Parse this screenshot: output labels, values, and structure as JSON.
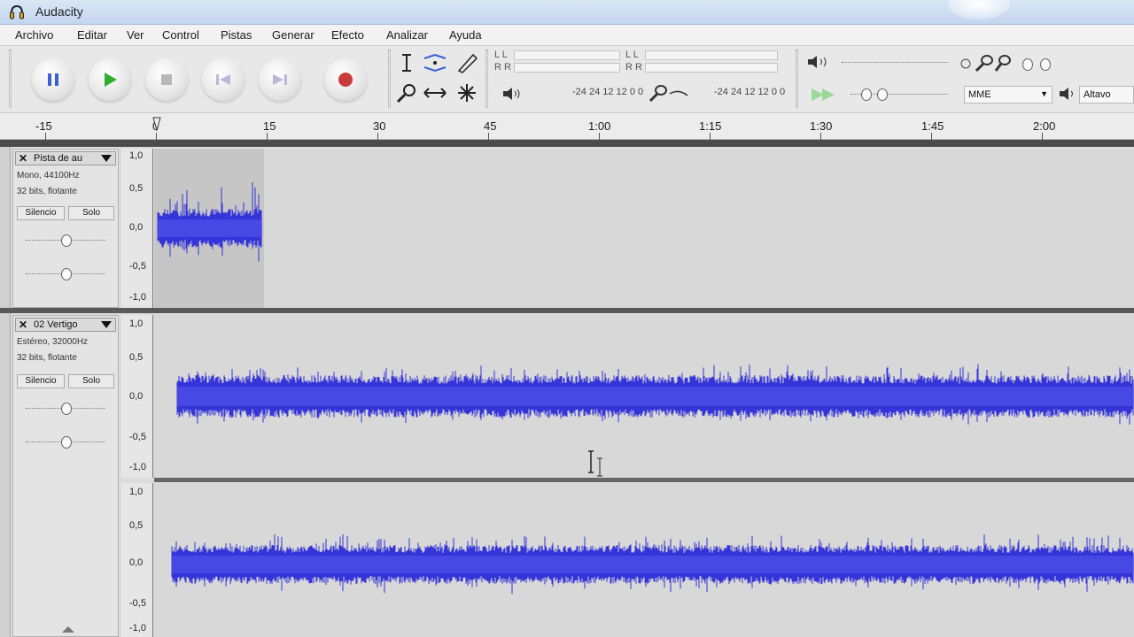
{
  "window": {
    "title": "Audacity"
  },
  "menu": {
    "items": [
      "Archivo",
      "Editar",
      "Ver",
      "Control",
      "Pistas",
      "Generar",
      "Efecto",
      "Analizar",
      "Ayuda"
    ]
  },
  "toolbar": {
    "transport": [
      "pause-icon",
      "play-icon",
      "stop-icon",
      "skip-start-icon",
      "skip-end-icon",
      "record-icon"
    ],
    "tools": [
      "selection-tool-icon",
      "envelope-tool-icon",
      "draw-tool-icon",
      "zoom-tool-icon",
      "timeshift-tool-icon",
      "multi-tool-icon"
    ],
    "meter_left_label": "L L",
    "meter_right_label": "R R",
    "meter_left_label_2": "L L",
    "meter_right_label_2": "R R",
    "meter_scale_a": "-24 24 12 12 0  0",
    "meter_scale_b": "-24 24 12 12 0  0",
    "device_combo": "MME",
    "output_combo": "Altavo",
    "colors": {
      "play": "#2fae2f",
      "pause": "#3a5fd6",
      "record": "#c93b3b",
      "disabled": "#b8b8b8"
    }
  },
  "ruler": {
    "labels": [
      "-15",
      "0",
      "15",
      "30",
      "45",
      "1:00",
      "1:15",
      "1:30",
      "1:45",
      "2:00"
    ]
  },
  "tracks": [
    {
      "name": "Pista de au",
      "info_line1": "Mono, 44100Hz",
      "info_line2": "32 bits, flotante",
      "mute": "Silencio",
      "solo": "Solo",
      "vscale": [
        "1,0",
        "0,5",
        "0,0",
        "-0,5",
        "-1,0"
      ]
    },
    {
      "name": "02 Vertigo",
      "info_line1": "Estéreo, 32000Hz",
      "info_line2": "32 bits, flotante",
      "mute": "Silencio",
      "solo": "Solo",
      "vscale_left": [
        "1,0",
        "0,5",
        "0,0",
        "-0,5",
        "-1,0"
      ],
      "vscale_right": [
        "1,0",
        "0,5",
        "0,0",
        "-0,5",
        "-1,0"
      ]
    }
  ],
  "colors": {
    "waveform": "#3434d8",
    "waveform_rms": "#5a5af0",
    "track_bg": "#d8d8d8",
    "selected_bg": "#c6c6c6"
  }
}
